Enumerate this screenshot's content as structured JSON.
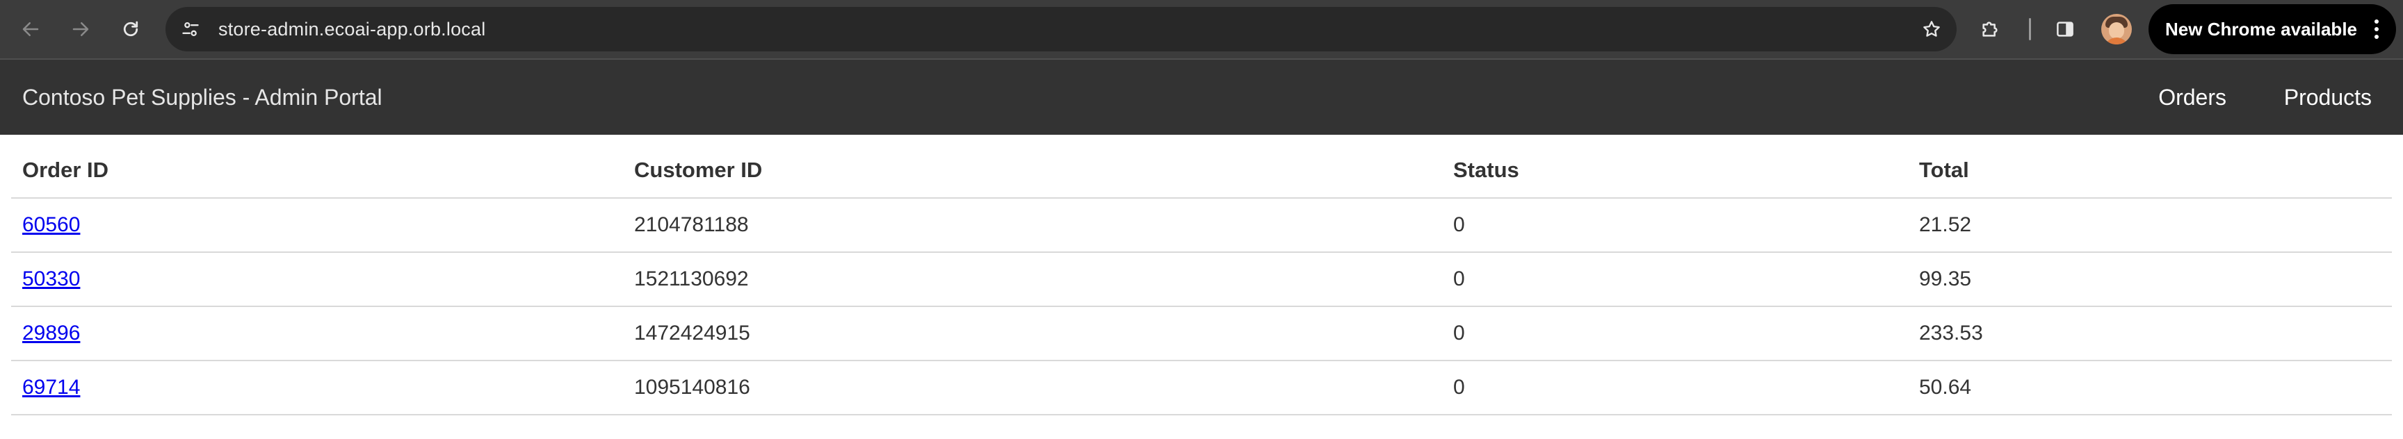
{
  "browser": {
    "url": "store-admin.ecoai-app.orb.local",
    "update_label": "New Chrome available",
    "icons": {
      "back": "arrow-left-icon",
      "forward": "arrow-right-icon",
      "reload": "reload-icon",
      "site_info": "tune-icon",
      "bookmark": "star-icon",
      "extensions": "puzzle-icon",
      "side_panel": "side-panel-icon",
      "menu": "kebab-menu-icon"
    }
  },
  "header": {
    "title": "Contoso Pet Supplies - Admin Portal",
    "nav": [
      {
        "label": "Orders"
      },
      {
        "label": "Products"
      }
    ]
  },
  "orders": {
    "columns": [
      "Order ID",
      "Customer ID",
      "Status",
      "Total"
    ],
    "rows": [
      {
        "order_id": "60560",
        "customer_id": "2104781188",
        "status": "0",
        "total": "21.52"
      },
      {
        "order_id": "50330",
        "customer_id": "1521130692",
        "status": "0",
        "total": "99.35"
      },
      {
        "order_id": "29896",
        "customer_id": "1472424915",
        "status": "0",
        "total": "233.53"
      },
      {
        "order_id": "69714",
        "customer_id": "1095140816",
        "status": "0",
        "total": "50.64"
      }
    ]
  },
  "colors": {
    "chrome_toolbar": "#3c3c3c",
    "omnibox": "#282828",
    "app_header": "#333333",
    "link": "#0000ee",
    "row_divider": "#d9d9d9"
  }
}
